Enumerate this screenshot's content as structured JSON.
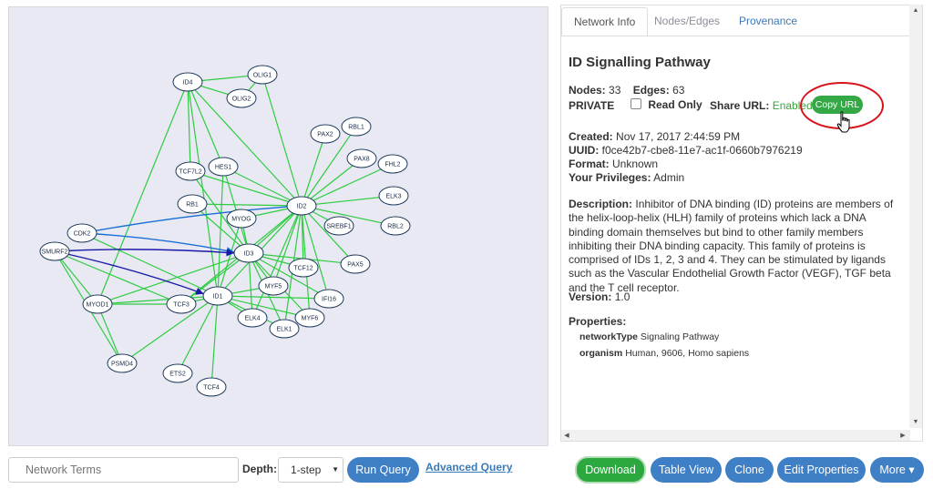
{
  "network_graph": {
    "nodes": [
      {
        "id": "ID4",
        "label": "ID4"
      },
      {
        "id": "OLIG1",
        "label": "OLIG1"
      },
      {
        "id": "OLIG2",
        "label": "OLIG2"
      },
      {
        "id": "PAX2",
        "label": "PAX2"
      },
      {
        "id": "RBL1",
        "label": "RBL1"
      },
      {
        "id": "PAX8",
        "label": "PAX8"
      },
      {
        "id": "FHL2",
        "label": "FHL2"
      },
      {
        "id": "TCF7L2",
        "label": "TCF7L2"
      },
      {
        "id": "HES1",
        "label": "HES1"
      },
      {
        "id": "ELK3",
        "label": "ELK3"
      },
      {
        "id": "RB1",
        "label": "RB1"
      },
      {
        "id": "ID2",
        "label": "ID2"
      },
      {
        "id": "MYOG",
        "label": "MYOG"
      },
      {
        "id": "SREBF1",
        "label": "SREBF1"
      },
      {
        "id": "RBL2",
        "label": "RBL2"
      },
      {
        "id": "CDK2",
        "label": "CDK2"
      },
      {
        "id": "SMURF2",
        "label": "SMURF2"
      },
      {
        "id": "ID3",
        "label": "ID3"
      },
      {
        "id": "PAX5",
        "label": "PAX5"
      },
      {
        "id": "TCF12",
        "label": "TCF12"
      },
      {
        "id": "MYF5",
        "label": "MYF5"
      },
      {
        "id": "MYOD1",
        "label": "MYOD1"
      },
      {
        "id": "TCF3",
        "label": "TCF3"
      },
      {
        "id": "ID1",
        "label": "ID1"
      },
      {
        "id": "IFI16",
        "label": "IFI16"
      },
      {
        "id": "ELK4",
        "label": "ELK4"
      },
      {
        "id": "MYF6",
        "label": "MYF6"
      },
      {
        "id": "ELK1",
        "label": "ELK1"
      },
      {
        "id": "PSMD4",
        "label": "PSMD4"
      },
      {
        "id": "ETS2",
        "label": "ETS2"
      },
      {
        "id": "TCF4",
        "label": "TCF4"
      }
    ]
  },
  "tabs": {
    "network_info": "Network Info",
    "nodes_edges": "Nodes/Edges",
    "provenance": "Provenance"
  },
  "info": {
    "title": "ID Signalling Pathway",
    "nodes_label": "Nodes:",
    "nodes_value": "33",
    "edges_label": "Edges:",
    "edges_value": "63",
    "visibility": "PRIVATE",
    "read_only_label": "Read Only",
    "share_url_label": "Share URL:",
    "share_url_status": "Enabled",
    "copy_url_label": "Copy URL",
    "created_label": "Created:",
    "created_value": "Nov 17, 2017 2:44:59 PM",
    "uuid_label": "UUID:",
    "uuid_value": "f0ce42b7-cbe8-11e7-ac1f-0660b7976219",
    "format_label": "Format:",
    "format_value": "Unknown",
    "privileges_label": "Your Privileges:",
    "privileges_value": "Admin",
    "description_label": "Description:",
    "description_value": "Inhibitor of DNA binding (ID) proteins are members of the helix-loop-helix (HLH) family of proteins which lack a DNA binding domain themselves but bind to other family members inhibiting their DNA binding capacity. This family of proteins is comprised of IDs 1, 2, 3 and 4. They can be stimulated by ligands such as the Vascular Endothelial Growth Factor (VEGF), TGF beta and the T cell receptor.",
    "version_label": "Version:",
    "version_value": "1.0",
    "properties_label": "Properties:",
    "properties": [
      {
        "key": "networkType",
        "value": "Signaling Pathway"
      },
      {
        "key": "organism",
        "value": "Human, 9606, Homo sapiens"
      }
    ]
  },
  "query": {
    "terms_placeholder": "Network Terms",
    "depth_label": "Depth:",
    "depth_value": "1-step",
    "run_query_label": "Run Query",
    "advanced_query_label": "Advanced Query"
  },
  "actions": {
    "download": "Download",
    "table_view": "Table View",
    "clone": "Clone",
    "edit_properties": "Edit Properties",
    "more": "More ▾"
  },
  "colors": {
    "edge": "#2ecc40",
    "edge_blue": "#1a6fd6",
    "edge_navy": "#1a1aa6",
    "node_fill": "#ffffff",
    "node_stroke": "#1f3a5c",
    "accent_blue": "#3f7fc5",
    "accent_green": "#2ba83e",
    "highlight_red": "#d8141b"
  }
}
